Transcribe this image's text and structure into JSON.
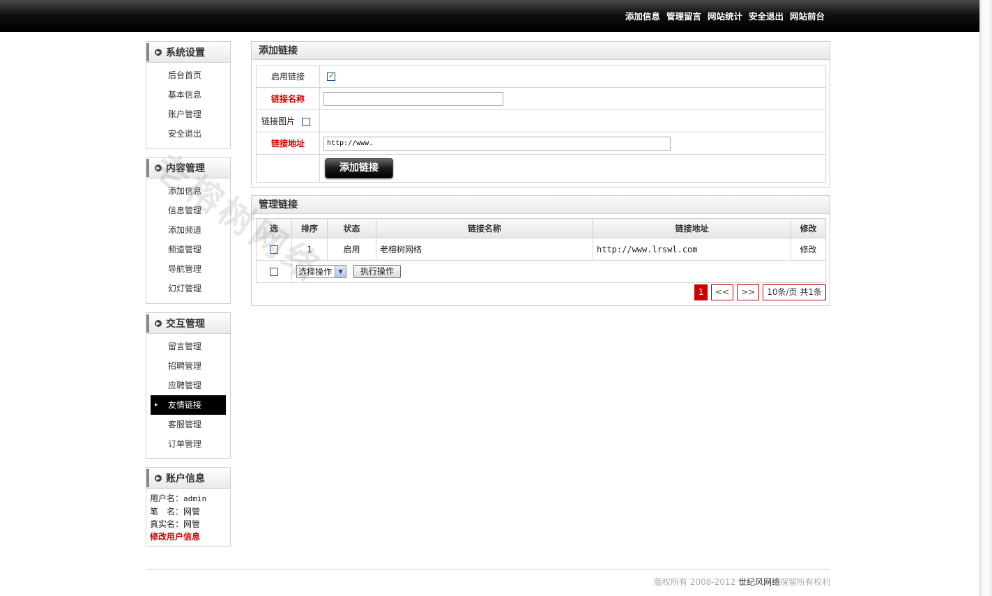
{
  "topnav": [
    "添加信息",
    "管理留言",
    "网站统计",
    "安全退出",
    "网站前台"
  ],
  "sidebar": [
    {
      "title": "系统设置",
      "items": [
        "后台首页",
        "基本信息",
        "账户管理",
        "安全退出"
      ]
    },
    {
      "title": "内容管理",
      "items": [
        "添加信息",
        "信息管理",
        "添加频道",
        "频道管理",
        "导航管理",
        "幻灯管理"
      ]
    },
    {
      "title": "交互管理",
      "items": [
        "留言管理",
        "招聘管理",
        "应聘管理",
        "友情链接",
        "客服管理",
        "订单管理"
      ],
      "active": "友情链接"
    }
  ],
  "account": {
    "title": "账户信息",
    "username_label": "用户名：",
    "username": "admin",
    "nick_label": "笔　名：",
    "nick": "网管",
    "realname_label": "真实名：",
    "realname": "网管",
    "edit": "修改用户信息"
  },
  "add_panel": {
    "title": "添加链接",
    "enable_label": "启用链接",
    "enable_checked": true,
    "name_label": "链接名称",
    "name_value": "",
    "image_label": "链接图片",
    "url_label": "链接地址",
    "url_value": "http://www.",
    "submit": "添加链接"
  },
  "list_panel": {
    "title": "管理链接",
    "headers": [
      "选",
      "排序",
      "状态",
      "链接名称",
      "链接地址",
      "修改"
    ],
    "rows": [
      {
        "order": "1",
        "status": "启用",
        "name": "老榕树网络",
        "url": "http://www.lrswl.com",
        "edit": "修改"
      }
    ],
    "select_label": "选择操作",
    "exec_label": "执行操作",
    "pager": {
      "current": "1",
      "prev": "<<",
      "next": ">>",
      "info": "10条/页 共1条"
    }
  },
  "footer": {
    "prefix": "版权所有 2008-2012 ",
    "brand": "世纪风网络",
    "suffix": "保留所有权利"
  },
  "watermark": "老榕树网络"
}
